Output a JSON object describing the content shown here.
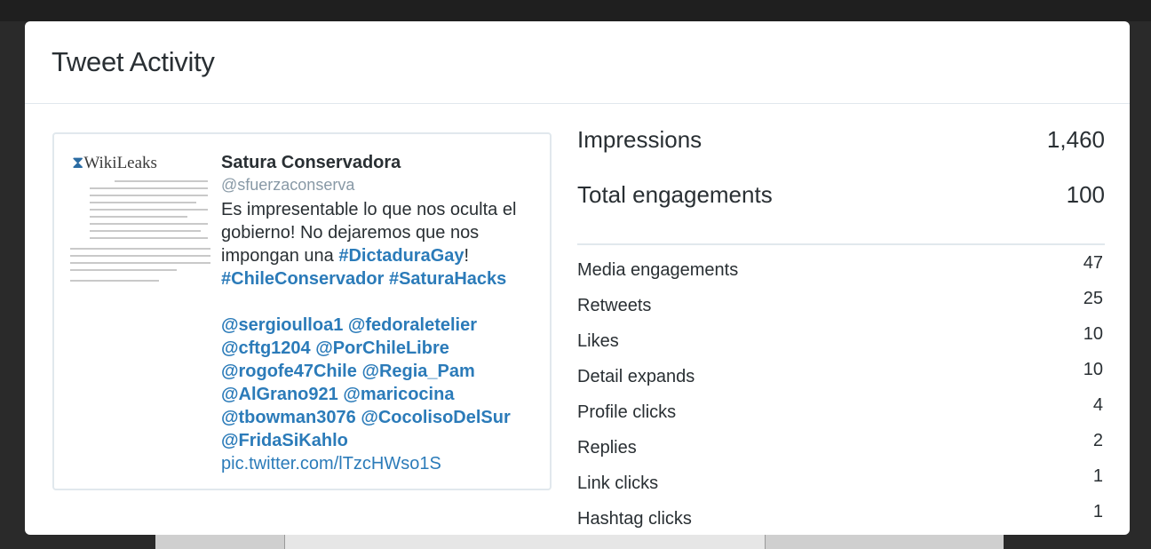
{
  "modal": {
    "title": "Tweet Activity"
  },
  "tweet": {
    "thumbnail_logo": "WikiLeaks",
    "author_name": "Satura Conservadora",
    "author_handle": "@sfuerzaconserva",
    "text_line_1": "Es impresentable lo que nos oculta el",
    "text_line_2": "gobierno! No dejaremos que nos",
    "text_line_3_prefix": "impongan una ",
    "hashtag_1": "#DictaduraGay",
    "text_line_3_suffix": "!",
    "hashtag_2": "#ChileConservador",
    "hashtag_3": "#SaturaHacks",
    "mentions": [
      "@sergioulloa1",
      "@fedoraletelier",
      "@cftg1204",
      "@PorChileLibre",
      "@rogofe47Chile",
      "@Regia_Pam",
      "@AlGrano921",
      "@maricocina",
      "@tbowman3076",
      "@CocolisoDelSur",
      "@FridaSiKahlo"
    ],
    "link": "pic.twitter.com/lTzcHWso1S"
  },
  "stats": {
    "impressions": {
      "label": "Impressions",
      "value": "1,460"
    },
    "total_engagements": {
      "label": "Total engagements",
      "value": "100"
    },
    "metrics": [
      {
        "label": "Media engagements",
        "value": "47"
      },
      {
        "label": "Retweets",
        "value": "25"
      },
      {
        "label": "Likes",
        "value": "10"
      },
      {
        "label": "Detail expands",
        "value": "10"
      },
      {
        "label": "Profile clicks",
        "value": "4"
      },
      {
        "label": "Replies",
        "value": "2"
      },
      {
        "label": "Link clicks",
        "value": "1"
      },
      {
        "label": "Hashtag clicks",
        "value": "1"
      }
    ]
  }
}
